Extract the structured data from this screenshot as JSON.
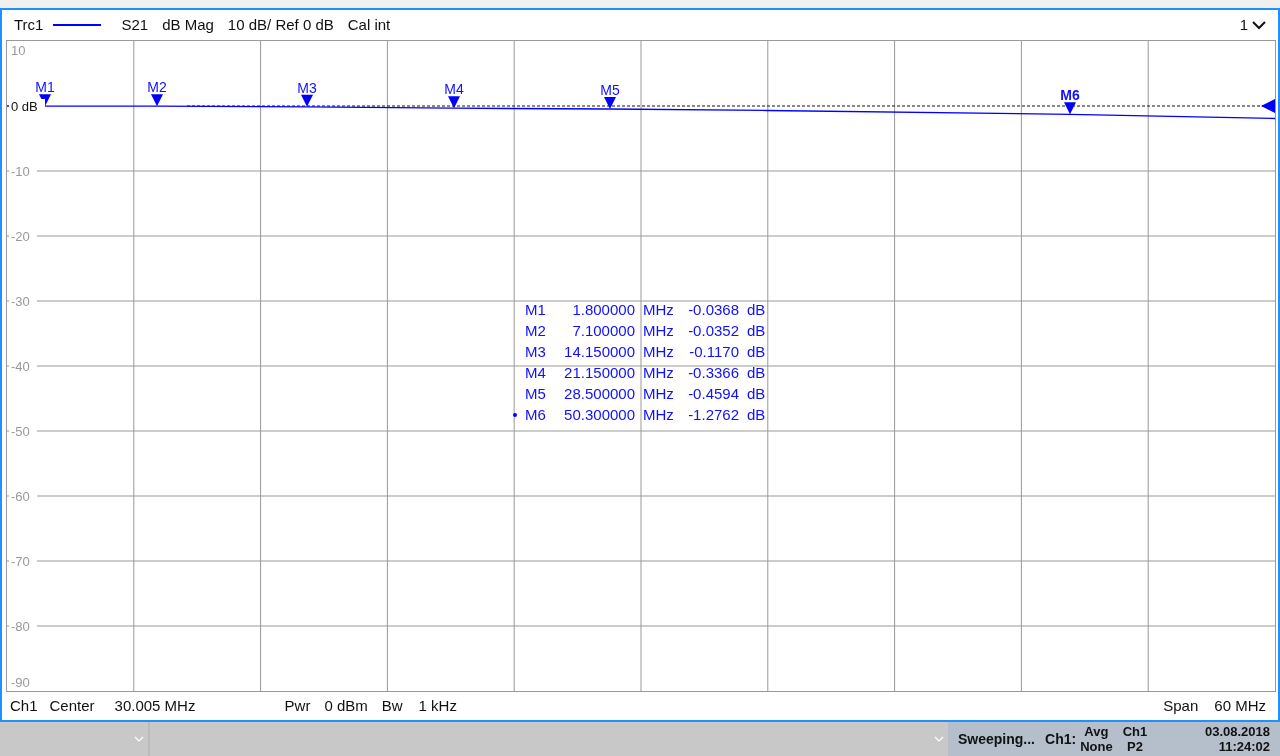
{
  "header": {
    "trace": "Trc1",
    "parameter": "S21",
    "format": "dB Mag",
    "scale": "10 dB/ Ref 0 dB",
    "calibration": "Cal int",
    "window_number": "1"
  },
  "diagram": {
    "y_axis_labels": [
      {
        "text": "10",
        "kind": "top"
      },
      {
        "text": "0 dB",
        "kind": "reference"
      },
      {
        "text": "-10",
        "kind": "grid"
      },
      {
        "text": "-20",
        "kind": "grid"
      },
      {
        "text": "-30",
        "kind": "grid"
      },
      {
        "text": "-40",
        "kind": "grid"
      },
      {
        "text": "-50",
        "kind": "grid"
      },
      {
        "text": "-60",
        "kind": "grid"
      },
      {
        "text": "-70",
        "kind": "grid"
      },
      {
        "text": "-80",
        "kind": "grid"
      },
      {
        "text": "-90",
        "kind": "bottom"
      }
    ],
    "markers": [
      {
        "label": "M1",
        "selected": false
      },
      {
        "label": "M2",
        "selected": false
      },
      {
        "label": "M3",
        "selected": false
      },
      {
        "label": "M4",
        "selected": false
      },
      {
        "label": "M5",
        "selected": false
      },
      {
        "label": "M6",
        "selected": true
      }
    ],
    "marker_table": [
      {
        "marker": "M1",
        "stimulus": "1.800000",
        "stimulus_unit": "MHz",
        "response": "-0.0368",
        "response_unit": "dB",
        "selected": false
      },
      {
        "marker": "M2",
        "stimulus": "7.100000",
        "stimulus_unit": "MHz",
        "response": "-0.0352",
        "response_unit": "dB",
        "selected": false
      },
      {
        "marker": "M3",
        "stimulus": "14.150000",
        "stimulus_unit": "MHz",
        "response": "-0.1170",
        "response_unit": "dB",
        "selected": false
      },
      {
        "marker": "M4",
        "stimulus": "21.150000",
        "stimulus_unit": "MHz",
        "response": "-0.3366",
        "response_unit": "dB",
        "selected": false
      },
      {
        "marker": "M5",
        "stimulus": "28.500000",
        "stimulus_unit": "MHz",
        "response": "-0.4594",
        "response_unit": "dB",
        "selected": false
      },
      {
        "marker": "M6",
        "stimulus": "50.300000",
        "stimulus_unit": "MHz",
        "response": "-1.2762",
        "response_unit": "dB",
        "selected": true
      }
    ]
  },
  "footer": {
    "channel": "Ch1",
    "center_label": "Center",
    "center_value": "30.005 MHz",
    "power_label": "Pwr",
    "power_value": "0 dBm",
    "bandwidth_label": "Bw",
    "bandwidth_value": "1 kHz",
    "span_label": "Span",
    "span_value": "60 MHz"
  },
  "status_bar": {
    "status": "Sweeping...",
    "channel": "Ch1:",
    "average_label": "Avg",
    "average_value": "None",
    "port_channel": "Ch1",
    "port": "P2",
    "date": "03.08.2018",
    "time": "11:24:02"
  }
}
